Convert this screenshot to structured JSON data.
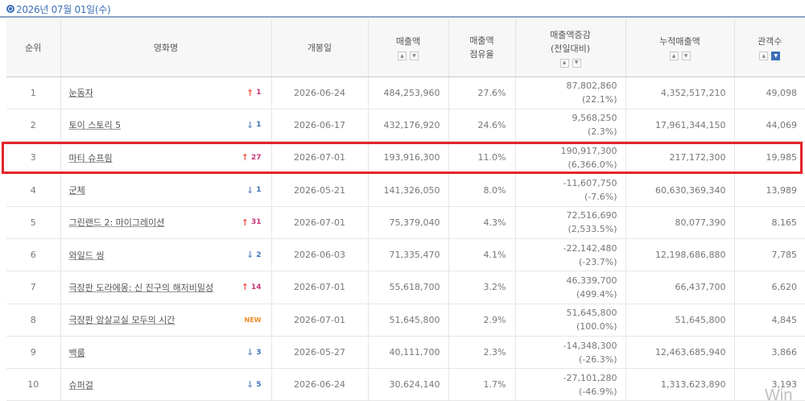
{
  "date_label": "2026년 07월 01일(수)",
  "columns": {
    "rank": "순위",
    "title": "영화명",
    "release": "개봉일",
    "sales": "매출액",
    "share_l1": "매출액",
    "share_l2": "점유율",
    "change_l1": "매출액증감",
    "change_l2": "(전일대비)",
    "cumulative": "누적매출액",
    "audience": "관객수"
  },
  "sort_icons": [
    "sort-up-icon",
    "sort-down-icon"
  ],
  "rows": [
    {
      "rank": "1",
      "title": "눈동자",
      "rank_change": {
        "dir": "up",
        "value": "1"
      },
      "release": "2026-06-24",
      "sales": "484,253,960",
      "share": "27.6%",
      "inc": "87,802,860",
      "inc_pct": "(22.1%)",
      "cumulative": "4,352,517,210",
      "audience": "49,098"
    },
    {
      "rank": "2",
      "title": "토이 스토리 5",
      "rank_change": {
        "dir": "down",
        "value": "1"
      },
      "release": "2026-06-17",
      "sales": "432,176,920",
      "share": "24.6%",
      "inc": "9,568,250",
      "inc_pct": "(2.3%)",
      "cumulative": "17,961,344,150",
      "audience": "44,069"
    },
    {
      "rank": "3",
      "title": "마티 슈프림",
      "rank_change": {
        "dir": "up",
        "value": "27"
      },
      "release": "2026-07-01",
      "sales": "193,916,300",
      "share": "11.0%",
      "inc": "190,917,300",
      "inc_pct": "(6,366.0%)",
      "cumulative": "217,172,300",
      "audience": "19,985"
    },
    {
      "rank": "4",
      "title": "군체",
      "rank_change": {
        "dir": "down",
        "value": "1"
      },
      "release": "2026-05-21",
      "sales": "141,326,050",
      "share": "8.0%",
      "inc": "-11,607,750",
      "inc_pct": "(-7.6%)",
      "cumulative": "60,630,369,340",
      "audience": "13,989"
    },
    {
      "rank": "5",
      "title": "그린랜드 2: 마이그레이션",
      "rank_change": {
        "dir": "up",
        "value": "31"
      },
      "release": "2026-07-01",
      "sales": "75,379,040",
      "share": "4.3%",
      "inc": "72,516,690",
      "inc_pct": "(2,533.5%)",
      "cumulative": "80,077,390",
      "audience": "8,165"
    },
    {
      "rank": "6",
      "title": "와일드 씽",
      "rank_change": {
        "dir": "down",
        "value": "2"
      },
      "release": "2026-06-03",
      "sales": "71,335,470",
      "share": "4.1%",
      "inc": "-22,142,480",
      "inc_pct": "(-23.7%)",
      "cumulative": "12,198,686,880",
      "audience": "7,785"
    },
    {
      "rank": "7",
      "title": "극장판 도라에몽: 신 진구의 해저비밀성",
      "rank_change": {
        "dir": "up",
        "value": "14"
      },
      "release": "2026-07-01",
      "sales": "55,618,700",
      "share": "3.2%",
      "inc": "46,339,700",
      "inc_pct": "(499.4%)",
      "cumulative": "66,437,700",
      "audience": "6,620"
    },
    {
      "rank": "8",
      "title": "극장판 암살교실 모두의 시간",
      "rank_change": {
        "dir": "new",
        "value": "NEW"
      },
      "release": "2026-07-01",
      "sales": "51,645,800",
      "share": "2.9%",
      "inc": "51,645,800",
      "inc_pct": "(100.0%)",
      "cumulative": "51,645,800",
      "audience": "4,845"
    },
    {
      "rank": "9",
      "title": "백룸",
      "rank_change": {
        "dir": "down",
        "value": "3"
      },
      "release": "2026-05-27",
      "sales": "40,111,700",
      "share": "2.3%",
      "inc": "-14,348,300",
      "inc_pct": "(-26.3%)",
      "cumulative": "12,463,685,940",
      "audience": "3,866"
    },
    {
      "rank": "10",
      "title": "슈퍼걸",
      "rank_change": {
        "dir": "down",
        "value": "5"
      },
      "release": "2026-06-24",
      "sales": "30,624,140",
      "share": "1.7%",
      "inc": "-27,101,280",
      "inc_pct": "(-46.9%)",
      "cumulative": "1,313,623,890",
      "audience": "3,193"
    }
  ],
  "highlighted_rank": "3",
  "watermark": "Win",
  "colors": {
    "accent": "#3d6fb6",
    "up": "#f05a4a",
    "down": "#6f92c8",
    "new": "#f08a24",
    "highlight": "#e3242b"
  }
}
